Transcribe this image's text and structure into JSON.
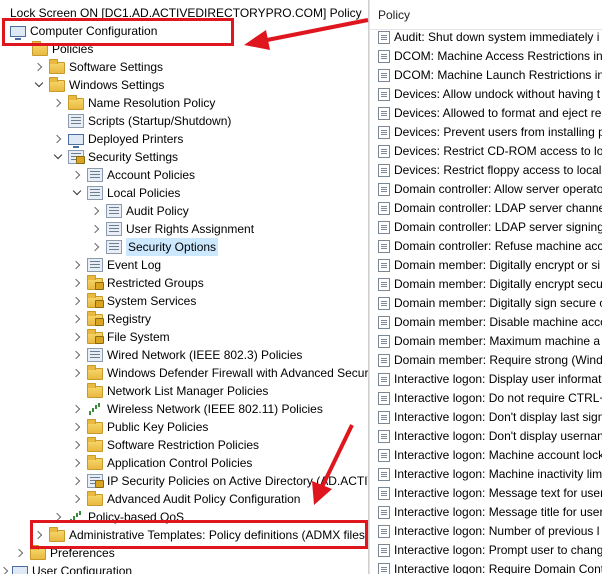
{
  "tree": {
    "title": "Lock Screen ON [DC1.AD.ACTIVEDIRECTORYPRO.COM] Policy",
    "computer_configuration": "Computer Configuration",
    "policies": "Policies",
    "software_settings": "Software Settings",
    "windows_settings": "Windows Settings",
    "name_resolution_policy": "Name Resolution Policy",
    "scripts": "Scripts (Startup/Shutdown)",
    "deployed_printers": "Deployed Printers",
    "security_settings": "Security Settings",
    "account_policies": "Account Policies",
    "local_policies": "Local Policies",
    "audit_policy": "Audit Policy",
    "user_rights_assignment": "User Rights Assignment",
    "security_options": "Security Options",
    "event_log": "Event Log",
    "restricted_groups": "Restricted Groups",
    "system_services": "System Services",
    "registry": "Registry",
    "file_system": "File System",
    "wired_network": "Wired Network (IEEE 802.3) Policies",
    "windows_defender_firewall": "Windows Defender Firewall with Advanced Secur",
    "network_list_manager": "Network List Manager Policies",
    "wireless_network": "Wireless Network (IEEE 802.11) Policies",
    "public_key_policies": "Public Key Policies",
    "software_restriction": "Software Restriction Policies",
    "application_control": "Application Control Policies",
    "ip_security": "IP Security Policies on Active Directory (AD.ACTIV",
    "advanced_audit": "Advanced Audit Policy Configuration",
    "policy_based_qos": "Policy-based QoS",
    "administrative_templates": "Administrative Templates: Policy definitions (ADMX files",
    "preferences": "Preferences",
    "user_configuration": "User Configuration"
  },
  "list": {
    "header": "Policy",
    "items": [
      "Audit: Shut down system immediately i",
      "DCOM: Machine Access Restrictions in",
      "DCOM: Machine Launch Restrictions in",
      "Devices: Allow undock without having t",
      "Devices: Allowed to format and eject re",
      "Devices: Prevent users from installing p",
      "Devices: Restrict CD-ROM access to loca",
      "Devices: Restrict floppy access to locally",
      "Domain controller: Allow server operato",
      "Domain controller: LDAP server channe",
      "Domain controller: LDAP server signing",
      "Domain controller: Refuse machine acc",
      "Domain member: Digitally encrypt or si",
      "Domain member: Digitally encrypt secu",
      "Domain member: Digitally sign secure c",
      "Domain member: Disable machine acco",
      "Domain member: Maximum machine a",
      "Domain member: Require strong (Wind",
      "Interactive logon: Display user informat",
      "Interactive logon: Do not require CTRL+",
      "Interactive logon: Don't display last sign",
      "Interactive logon: Don't display usernan",
      "Interactive logon: Machine account lock",
      "Interactive logon: Machine inactivity lim",
      "Interactive logon: Message text for user",
      "Interactive logon: Message title for user",
      "Interactive logon: Number of previous l",
      "Interactive logon: Prompt user to chang",
      "Interactive logon: Require Domain Contr"
    ]
  },
  "colors": {
    "annotation_red": "#e0161e",
    "selection_blue": "#cce8ff"
  }
}
